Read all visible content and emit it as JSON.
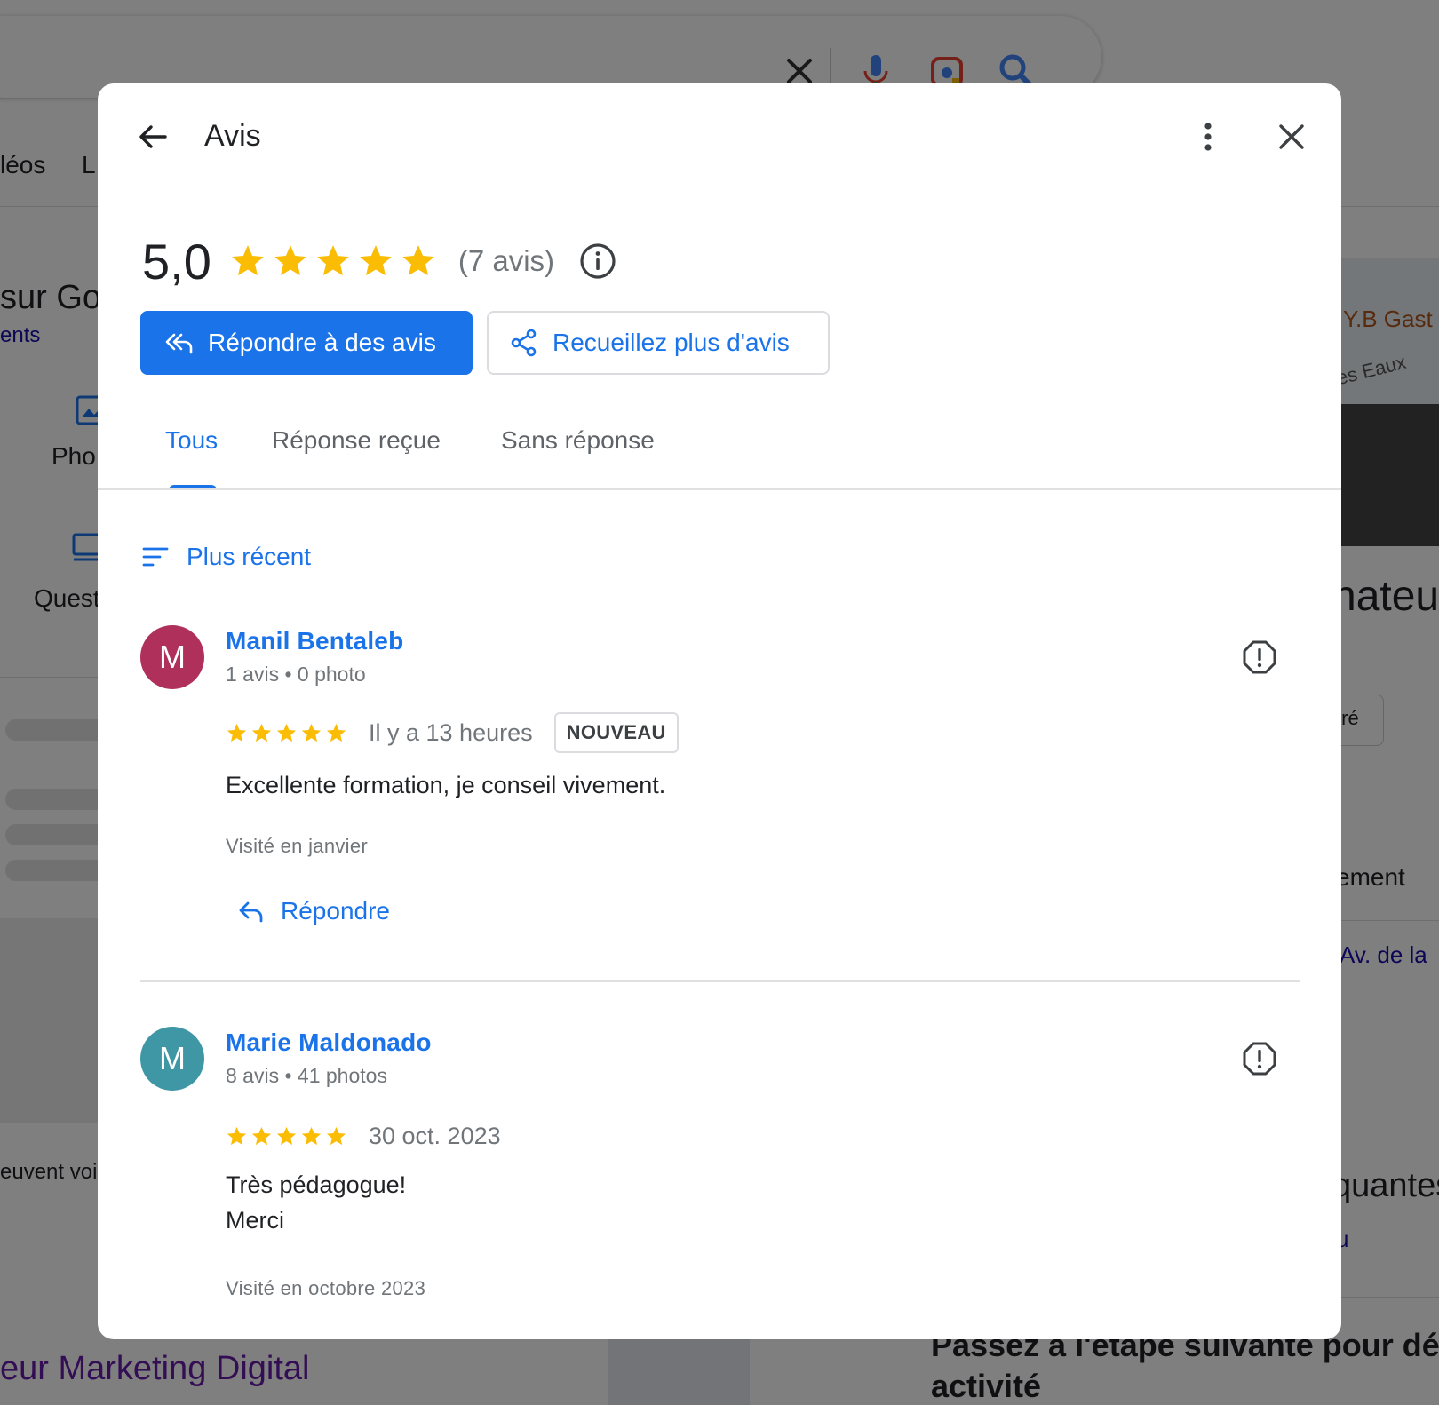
{
  "background": {
    "tab_fragments": [
      "léos",
      "L"
    ],
    "left_fragments": [
      "sur Goo",
      "ents",
      "Pho",
      "Quest",
      "euvent voi"
    ],
    "bottom_left_title": "eur Marketing Digital",
    "right_fragments": [
      "Y.B Gast",
      "es Eaux",
      "nateur",
      "tré",
      "ement",
      "Av. de la",
      "quantes",
      "u"
    ],
    "bottom_right_title": "Passez à l'étape suivante pour dé",
    "bottom_right_title_2": "activité"
  },
  "modal": {
    "title": "Avis",
    "back_icon": "arrow-left-icon",
    "more_icon": "more-vert-icon",
    "close_icon": "close-icon",
    "rating": {
      "value": "5,0",
      "stars": 5,
      "count_label": "(7 avis)",
      "info_icon": "info-icon"
    },
    "actions": {
      "reply_label": "Répondre à des avis",
      "collect_label": "Recueillez plus d'avis"
    },
    "tabs": [
      {
        "label": "Tous",
        "active": true
      },
      {
        "label": "Réponse reçue",
        "active": false
      },
      {
        "label": "Sans réponse",
        "active": false
      }
    ],
    "sort_label": "Plus récent",
    "reviews": [
      {
        "initial": "M",
        "avatar_color": "#b0305c",
        "author": "Manil Bentaleb",
        "meta": "1 avis • 0 photo",
        "stars": 5,
        "date": "Il y a 13 heures",
        "badge": "NOUVEAU",
        "text": "Excellente formation, je conseil vivement.",
        "visited": "Visité en janvier",
        "reply_label": "Répondre"
      },
      {
        "initial": "M",
        "avatar_color": "#3f97a6",
        "author": "Marie Maldonado",
        "meta": "8 avis • 41 photos",
        "stars": 5,
        "date": "30 oct. 2023",
        "text": "Très pédagogue!\nMerci",
        "visited": "Visité en octobre 2023"
      }
    ]
  },
  "colors": {
    "accent": "#1a73e8",
    "star": "#fbbc04",
    "overlay": "rgba(0,0,0,0.5)"
  }
}
